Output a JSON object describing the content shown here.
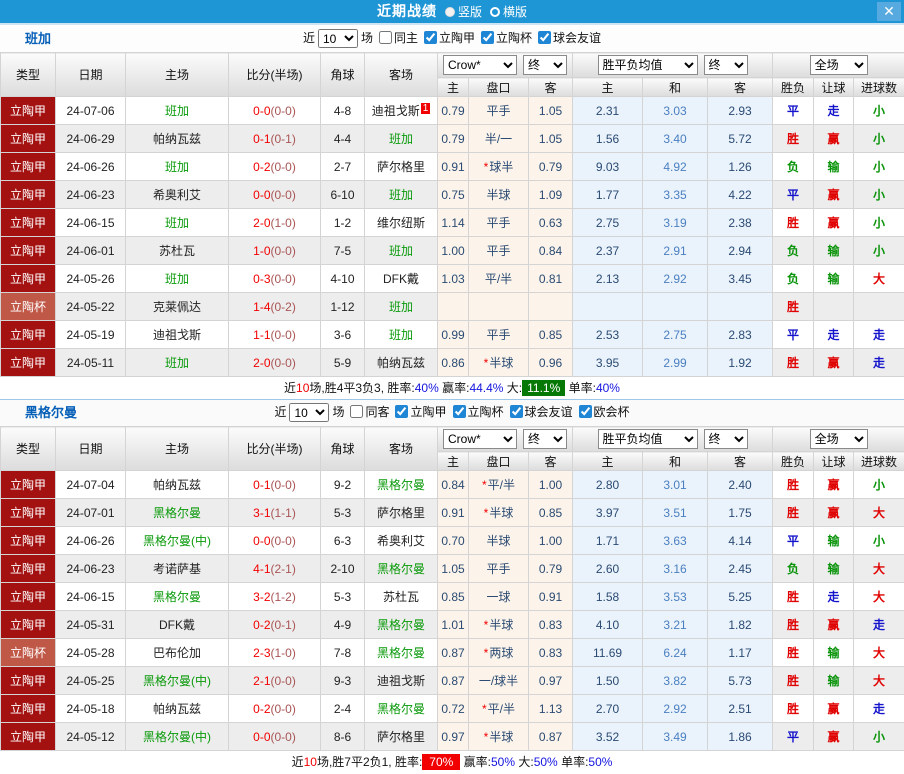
{
  "titlebar": {
    "title": "近期战绩",
    "radios": [
      {
        "label": "竖版",
        "selected": true
      },
      {
        "label": "横版",
        "selected": false
      }
    ],
    "close": "✕"
  },
  "table_header": {
    "left_cols": [
      "类型",
      "日期",
      "主场",
      "比分(半场)",
      "角球",
      "客场"
    ],
    "odds_company": "Crow*",
    "final": "终",
    "avg": "胜平负均值",
    "scope": "全场",
    "odds_sub": [
      "主",
      "盘口",
      "客"
    ],
    "avg_sub": [
      "主",
      "和",
      "客"
    ],
    "result_sub": [
      "胜负",
      "让球",
      "进球数"
    ]
  },
  "sections": [
    {
      "team": "班加",
      "filter": {
        "prefix": "近",
        "count": "10",
        "suffix": "场",
        "same": {
          "label": "同主",
          "checked": false
        },
        "comps": [
          {
            "label": "立陶甲",
            "checked": true
          },
          {
            "label": "立陶杯",
            "checked": true
          },
          {
            "label": "球会友谊",
            "checked": true
          }
        ]
      },
      "rows": [
        {
          "type": "立陶甲",
          "cls": "jia",
          "date": "24-07-06",
          "home": "班加",
          "hs": true,
          "ft": "0-0",
          "ht": "(0-0)",
          "cn": "4-8",
          "away": "迪祖戈斯",
          "as": false,
          "card": "1",
          "oh": "0.79",
          "hc": "平手",
          "st": false,
          "oa": "1.05",
          "ah": "2.31",
          "ad": "3.03",
          "aa": "2.93",
          "r1": "平",
          "r2": "走",
          "r3": "小"
        },
        {
          "type": "立陶甲",
          "cls": "jia",
          "date": "24-06-29",
          "home": "帕纳瓦兹",
          "hs": false,
          "ft": "0-1",
          "ht": "(0-1)",
          "cn": "4-4",
          "away": "班加",
          "as": true,
          "oh": "0.79",
          "hc": "半/一",
          "st": false,
          "oa": "1.05",
          "ah": "1.56",
          "ad": "3.40",
          "aa": "5.72",
          "r1": "胜",
          "r2": "赢",
          "r3": "小"
        },
        {
          "type": "立陶甲",
          "cls": "jia",
          "date": "24-06-26",
          "home": "班加",
          "hs": true,
          "ft": "0-2",
          "ht": "(0-0)",
          "cn": "2-7",
          "away": "萨尔格里",
          "as": false,
          "oh": "0.91",
          "hc": "球半",
          "st": true,
          "oa": "0.79",
          "ah": "9.03",
          "ad": "4.92",
          "aa": "1.26",
          "r1": "负",
          "r2": "输",
          "r3": "小"
        },
        {
          "type": "立陶甲",
          "cls": "jia",
          "date": "24-06-23",
          "home": "希奥利艾",
          "hs": false,
          "ft": "0-0",
          "ht": "(0-0)",
          "cn": "6-10",
          "away": "班加",
          "as": true,
          "oh": "0.75",
          "hc": "半球",
          "st": false,
          "oa": "1.09",
          "ah": "1.77",
          "ad": "3.35",
          "aa": "4.22",
          "r1": "平",
          "r2": "赢",
          "r3": "小"
        },
        {
          "type": "立陶甲",
          "cls": "jia",
          "date": "24-06-15",
          "home": "班加",
          "hs": true,
          "ft": "2-0",
          "ht": "(1-0)",
          "cn": "1-2",
          "away": "维尔纽斯",
          "as": false,
          "oh": "1.14",
          "hc": "平手",
          "st": false,
          "oa": "0.63",
          "ah": "2.75",
          "ad": "3.19",
          "aa": "2.38",
          "r1": "胜",
          "r2": "赢",
          "r3": "小"
        },
        {
          "type": "立陶甲",
          "cls": "jia",
          "date": "24-06-01",
          "home": "苏杜瓦",
          "hs": false,
          "ft": "1-0",
          "ht": "(0-0)",
          "cn": "7-5",
          "away": "班加",
          "as": true,
          "oh": "1.00",
          "hc": "平手",
          "st": false,
          "oa": "0.84",
          "ah": "2.37",
          "ad": "2.91",
          "aa": "2.94",
          "r1": "负",
          "r2": "输",
          "r3": "小"
        },
        {
          "type": "立陶甲",
          "cls": "jia",
          "date": "24-05-26",
          "home": "班加",
          "hs": true,
          "ft": "0-3",
          "ht": "(0-0)",
          "cn": "4-10",
          "away": "DFK戴",
          "as": false,
          "oh": "1.03",
          "hc": "平/半",
          "st": false,
          "oa": "0.81",
          "ah": "2.13",
          "ad": "2.92",
          "aa": "3.45",
          "r1": "负",
          "r2": "输",
          "r3": "大"
        },
        {
          "type": "立陶杯",
          "cls": "bei",
          "date": "24-05-22",
          "home": "克莱佩达",
          "hs": false,
          "ft": "1-4",
          "ht": "(0-2)",
          "cn": "1-12",
          "away": "班加",
          "as": true,
          "oh": "",
          "hc": "",
          "st": false,
          "oa": "",
          "ah": "",
          "ad": "",
          "aa": "",
          "r1": "胜",
          "r2": "",
          "r3": ""
        },
        {
          "type": "立陶甲",
          "cls": "jia",
          "date": "24-05-19",
          "home": "迪祖戈斯",
          "hs": false,
          "ft": "1-1",
          "ht": "(0-0)",
          "cn": "3-6",
          "away": "班加",
          "as": true,
          "oh": "0.99",
          "hc": "平手",
          "st": false,
          "oa": "0.85",
          "ah": "2.53",
          "ad": "2.75",
          "aa": "2.83",
          "r1": "平",
          "r2": "走",
          "r3": "走"
        },
        {
          "type": "立陶甲",
          "cls": "jia",
          "date": "24-05-11",
          "home": "班加",
          "hs": true,
          "ft": "2-0",
          "ht": "(0-0)",
          "cn": "5-9",
          "away": "帕纳瓦兹",
          "as": false,
          "oh": "0.86",
          "hc": "半球",
          "st": true,
          "oa": "0.96",
          "ah": "3.95",
          "ad": "2.99",
          "aa": "1.92",
          "r1": "胜",
          "r2": "赢",
          "r3": "走"
        }
      ],
      "summary": [
        {
          "t": "近"
        },
        {
          "t": "10",
          "c": "s-red"
        },
        {
          "t": "场,胜4平3负3, 胜率:"
        },
        {
          "t": "40%",
          "c": "s-blue"
        },
        {
          "t": " 赢率:"
        },
        {
          "t": "44.4%",
          "c": "s-blue"
        },
        {
          "t": " 大:"
        },
        {
          "t": "11.1%",
          "c": "badge-green"
        },
        {
          "t": " 单率:"
        },
        {
          "t": "40%",
          "c": "s-blue"
        }
      ]
    },
    {
      "team": "黑格尔曼",
      "filter": {
        "prefix": "近",
        "count": "10",
        "suffix": "场",
        "same": {
          "label": "同客",
          "checked": false
        },
        "comps": [
          {
            "label": "立陶甲",
            "checked": true
          },
          {
            "label": "立陶杯",
            "checked": true
          },
          {
            "label": "球会友谊",
            "checked": true
          },
          {
            "label": "欧会杯",
            "checked": true
          }
        ]
      },
      "rows": [
        {
          "type": "立陶甲",
          "cls": "jia",
          "date": "24-07-04",
          "home": "帕纳瓦兹",
          "hs": false,
          "ft": "0-1",
          "ht": "(0-0)",
          "cn": "9-2",
          "away": "黑格尔曼",
          "as": true,
          "oh": "0.84",
          "hc": "平/半",
          "st": true,
          "oa": "1.00",
          "ah": "2.80",
          "ad": "3.01",
          "aa": "2.40",
          "r1": "胜",
          "r2": "赢",
          "r3": "小"
        },
        {
          "type": "立陶甲",
          "cls": "jia",
          "date": "24-07-01",
          "home": "黑格尔曼",
          "hs": true,
          "ft": "3-1",
          "ht": "(1-1)",
          "cn": "5-3",
          "away": "萨尔格里",
          "as": false,
          "oh": "0.91",
          "hc": "半球",
          "st": true,
          "oa": "0.85",
          "ah": "3.97",
          "ad": "3.51",
          "aa": "1.75",
          "r1": "胜",
          "r2": "赢",
          "r3": "大"
        },
        {
          "type": "立陶甲",
          "cls": "jia",
          "date": "24-06-26",
          "home": "黑格尔曼(中)",
          "hs": true,
          "ft": "0-0",
          "ht": "(0-0)",
          "cn": "6-3",
          "away": "希奥利艾",
          "as": false,
          "oh": "0.70",
          "hc": "半球",
          "st": false,
          "oa": "1.00",
          "ah": "1.71",
          "ad": "3.63",
          "aa": "4.14",
          "r1": "平",
          "r2": "输",
          "r3": "小"
        },
        {
          "type": "立陶甲",
          "cls": "jia",
          "date": "24-06-23",
          "home": "考诺萨基",
          "hs": false,
          "ft": "4-1",
          "ht": "(2-1)",
          "cn": "2-10",
          "away": "黑格尔曼",
          "as": true,
          "oh": "1.05",
          "hc": "平手",
          "st": false,
          "oa": "0.79",
          "ah": "2.60",
          "ad": "3.16",
          "aa": "2.45",
          "r1": "负",
          "r2": "输",
          "r3": "大"
        },
        {
          "type": "立陶甲",
          "cls": "jia",
          "date": "24-06-15",
          "home": "黑格尔曼",
          "hs": true,
          "ft": "3-2",
          "ht": "(1-2)",
          "cn": "5-3",
          "away": "苏杜瓦",
          "as": false,
          "oh": "0.85",
          "hc": "一球",
          "st": false,
          "oa": "0.91",
          "ah": "1.58",
          "ad": "3.53",
          "aa": "5.25",
          "r1": "胜",
          "r2": "走",
          "r3": "大"
        },
        {
          "type": "立陶甲",
          "cls": "jia",
          "date": "24-05-31",
          "home": "DFK戴",
          "hs": false,
          "ft": "0-2",
          "ht": "(0-1)",
          "cn": "4-9",
          "away": "黑格尔曼",
          "as": true,
          "oh": "1.01",
          "hc": "半球",
          "st": true,
          "oa": "0.83",
          "ah": "4.10",
          "ad": "3.21",
          "aa": "1.82",
          "r1": "胜",
          "r2": "赢",
          "r3": "走"
        },
        {
          "type": "立陶杯",
          "cls": "bei",
          "date": "24-05-28",
          "home": "巴布伦加",
          "hs": false,
          "ft": "2-3",
          "ht": "(1-0)",
          "cn": "7-8",
          "away": "黑格尔曼",
          "as": true,
          "oh": "0.87",
          "hc": "两球",
          "st": true,
          "oa": "0.83",
          "ah": "11.69",
          "ad": "6.24",
          "aa": "1.17",
          "r1": "胜",
          "r2": "输",
          "r3": "大"
        },
        {
          "type": "立陶甲",
          "cls": "jia",
          "date": "24-05-25",
          "home": "黑格尔曼(中)",
          "hs": true,
          "ft": "2-1",
          "ht": "(0-0)",
          "cn": "9-3",
          "away": "迪祖戈斯",
          "as": false,
          "oh": "0.87",
          "hc": "一/球半",
          "st": false,
          "oa": "0.97",
          "ah": "1.50",
          "ad": "3.82",
          "aa": "5.73",
          "r1": "胜",
          "r2": "输",
          "r3": "大"
        },
        {
          "type": "立陶甲",
          "cls": "jia",
          "date": "24-05-18",
          "home": "帕纳瓦兹",
          "hs": false,
          "ft": "0-2",
          "ht": "(0-0)",
          "cn": "2-4",
          "away": "黑格尔曼",
          "as": true,
          "oh": "0.72",
          "hc": "平/半",
          "st": true,
          "oa": "1.13",
          "ah": "2.70",
          "ad": "2.92",
          "aa": "2.51",
          "r1": "胜",
          "r2": "赢",
          "r3": "走"
        },
        {
          "type": "立陶甲",
          "cls": "jia",
          "date": "24-05-12",
          "home": "黑格尔曼(中)",
          "hs": true,
          "ft": "0-0",
          "ht": "(0-0)",
          "cn": "8-6",
          "away": "萨尔格里",
          "as": false,
          "oh": "0.97",
          "hc": "半球",
          "st": true,
          "oa": "0.87",
          "ah": "3.52",
          "ad": "3.49",
          "aa": "1.86",
          "r1": "平",
          "r2": "赢",
          "r3": "小"
        }
      ],
      "summary": [
        {
          "t": "近"
        },
        {
          "t": "10",
          "c": "s-red"
        },
        {
          "t": "场,胜7平2负1, 胜率:"
        },
        {
          "t": "70%",
          "c": "badge-red"
        },
        {
          "t": " 赢率:"
        },
        {
          "t": "50%",
          "c": "s-blue"
        },
        {
          "t": " 大:"
        },
        {
          "t": "50%",
          "c": "s-blue"
        },
        {
          "t": " 单率:"
        },
        {
          "t": "50%",
          "c": "s-blue"
        }
      ]
    }
  ]
}
